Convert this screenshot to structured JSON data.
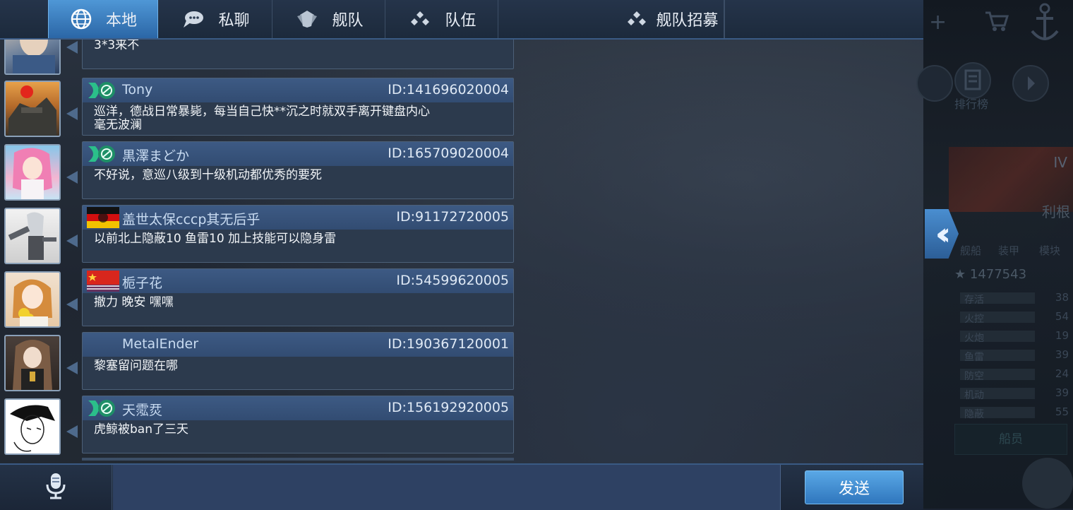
{
  "tabs": [
    {
      "label": "本地",
      "icon": "globe-icon",
      "active": true
    },
    {
      "label": "私聊",
      "icon": "chat-bubble-icon",
      "active": false
    },
    {
      "label": "舰队",
      "icon": "fleet-shield-icon",
      "active": false
    },
    {
      "label": "队伍",
      "icon": "team-dots-icon",
      "active": false
    },
    {
      "label": "舰队招募",
      "icon": "team-dots-icon",
      "active": false
    }
  ],
  "messages": [
    {
      "name": "",
      "id": "",
      "text": "3*3来不",
      "flag": "none"
    },
    {
      "name": "Tony",
      "id": "ID:141696020004",
      "text": "巡洋，德战日常暴毙，每当自己快**沉之时就双手离开键盘内心\n 毫无波澜",
      "flag": "green-emblem"
    },
    {
      "name": "黒澤まどか",
      "id": "ID:165709020004",
      "text": "不好说，意巡八级到十级机动都优秀的要死",
      "flag": "green-emblem"
    },
    {
      "name": "盖世太保cccp其无后乎",
      "id": "ID:91172720005",
      "text": "以前北上隐蔽10 鱼雷10 加上技能可以隐身雷",
      "flag": "german-flag"
    },
    {
      "name": "栀子花",
      "id": "ID:54599620005",
      "text": "撤力 晚安 嘿嘿",
      "flag": "china-flag"
    },
    {
      "name": "MetalEnder",
      "id": "ID:190367120001",
      "text": "黎塞留问题在哪",
      "flag": "none"
    },
    {
      "name": "天霐烎",
      "id": "ID:156192920005",
      "text": "虎鲸被ban了三天",
      "flag": "green-emblem"
    }
  ],
  "input": {
    "placeholder": "",
    "value": ""
  },
  "send_label": "发送",
  "side_panel": {
    "tier": "IV",
    "ship_name": "利根",
    "leaderboard_label": "排行榜",
    "tabs": [
      "舰船",
      "装甲",
      "模块"
    ],
    "score": "1477543",
    "stats": [
      {
        "name": "存活",
        "value": "38"
      },
      {
        "name": "火控",
        "value": "54"
      },
      {
        "name": "火炮",
        "value": "19"
      },
      {
        "name": "鱼雷",
        "value": "39"
      },
      {
        "name": "防空",
        "value": "24"
      },
      {
        "name": "机动",
        "value": "39"
      },
      {
        "name": "隐蔽",
        "value": "55"
      }
    ],
    "crew_label": "船员"
  },
  "colors": {
    "accent": "#3f86c9",
    "bubble": "#2c3a4d",
    "header": "#35507a"
  }
}
